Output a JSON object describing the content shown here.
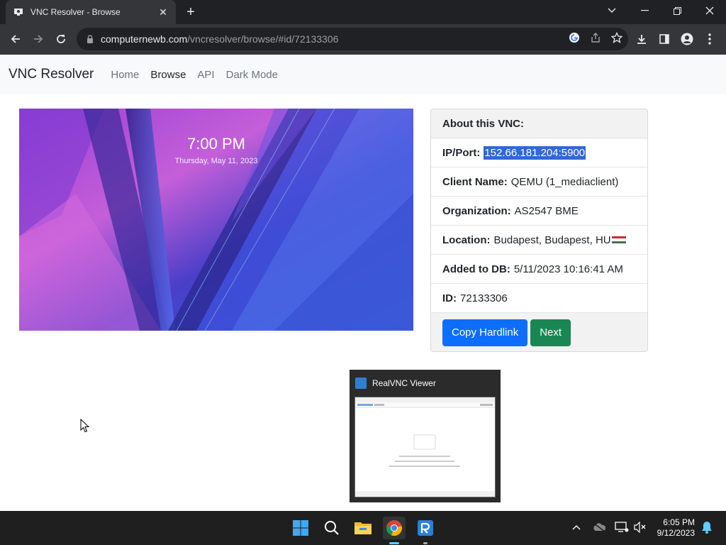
{
  "browser": {
    "tab_title": "VNC Resolver - Browse",
    "url_host": "computernewb.com",
    "url_path": "/vncresolver/browse/#id/72133306"
  },
  "navbar": {
    "brand": "VNC Resolver",
    "links": [
      "Home",
      "Browse",
      "API",
      "Dark Mode"
    ],
    "active": "Browse"
  },
  "screenshot": {
    "time": "7:00 PM",
    "date": "Thursday, May 11, 2023"
  },
  "card": {
    "header": "About this VNC:",
    "rows": [
      {
        "label": "IP/Port:",
        "value": "152.66.181.204:5900"
      },
      {
        "label": "Client Name:",
        "value": "QEMU (1_mediaclient)"
      },
      {
        "label": "Organization:",
        "value": "AS2547 BME"
      },
      {
        "label": "Location:",
        "value": "Budapest, Budapest, HU"
      },
      {
        "label": "Added to DB:",
        "value": "5/11/2023 10:16:41 AM"
      },
      {
        "label": "ID:",
        "value": "72133306"
      }
    ],
    "copy_button": "Copy Hardlink",
    "next_button": "Next"
  },
  "thumbnail": {
    "title": "RealVNC Viewer"
  },
  "taskbar": {
    "time": "6:05 PM",
    "date": "9/12/2023"
  },
  "colors": {
    "primary": "#0d6efd",
    "success": "#198754",
    "selection": "#3367d6"
  }
}
